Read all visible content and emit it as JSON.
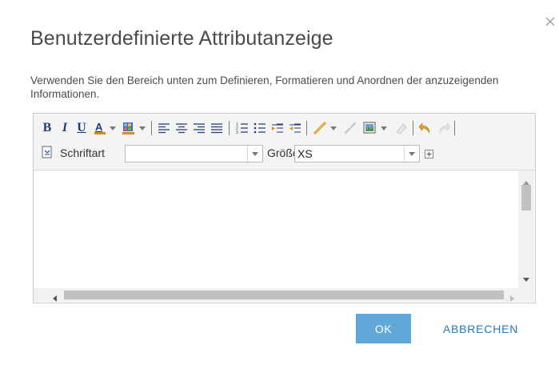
{
  "dialog": {
    "title": "Benutzerdefinierte Attributanzeige",
    "description": "Verwenden Sie den Bereich unten zum Definieren, Formatieren und Anordnen der anzuzeigenden Informationen."
  },
  "toolbar": {
    "bold": "B",
    "italic": "I",
    "underline": "U",
    "font_label": "Schriftart",
    "font_value": "",
    "size_label": "Größe",
    "size_value": "XS"
  },
  "buttons": {
    "ok": "OK",
    "cancel": "ABBRECHEN"
  },
  "colors": {
    "accent": "#5fa8d8",
    "link": "#2a78b9",
    "icon_blue": "#1f3c7a",
    "icon_orange": "#e08a1e"
  }
}
